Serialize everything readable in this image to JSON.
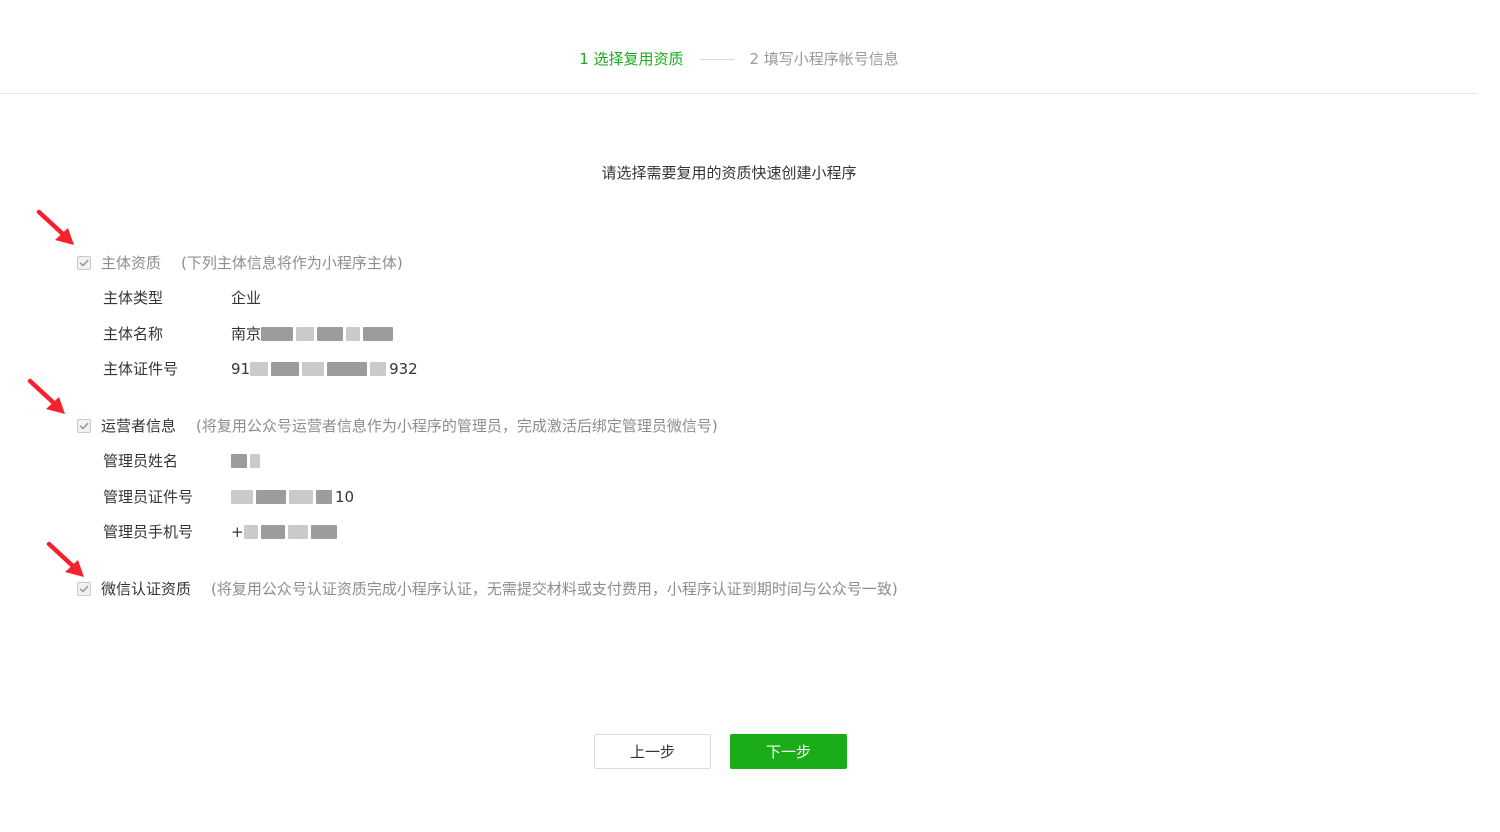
{
  "steps": {
    "step1": "1 选择复用资质",
    "step2": "2 填写小程序帐号信息"
  },
  "intro": "请选择需要复用的资质快速创建小程序",
  "sections": {
    "subject": {
      "title": "主体资质",
      "note": "(下列主体信息将作为小程序主体)",
      "checked": true,
      "fields": [
        {
          "label": "主体类型",
          "value": "企业"
        },
        {
          "label": "主体名称",
          "value": "南京"
        },
        {
          "label": "主体证件号",
          "value_prefix": "91",
          "value_suffix": "932"
        }
      ]
    },
    "operator": {
      "title": "运营者信息",
      "note": "(将复用公众号运营者信息作为小程序的管理员，完成激活后绑定管理员微信号)",
      "checked": true,
      "fields": [
        {
          "label": "管理员姓名"
        },
        {
          "label": "管理员证件号",
          "value_suffix": "10"
        },
        {
          "label": "管理员手机号",
          "value_prefix": "+"
        }
      ]
    },
    "wechat_cert": {
      "title": "微信认证资质",
      "note": "(将复用公众号认证资质完成小程序认证，无需提交材料或支付费用，小程序认证到期时间与公众号一致)",
      "checked": true
    }
  },
  "buttons": {
    "prev": "上一步",
    "next": "下一步"
  },
  "colors": {
    "accent": "#1aad19",
    "annotation": "#f5222d"
  }
}
